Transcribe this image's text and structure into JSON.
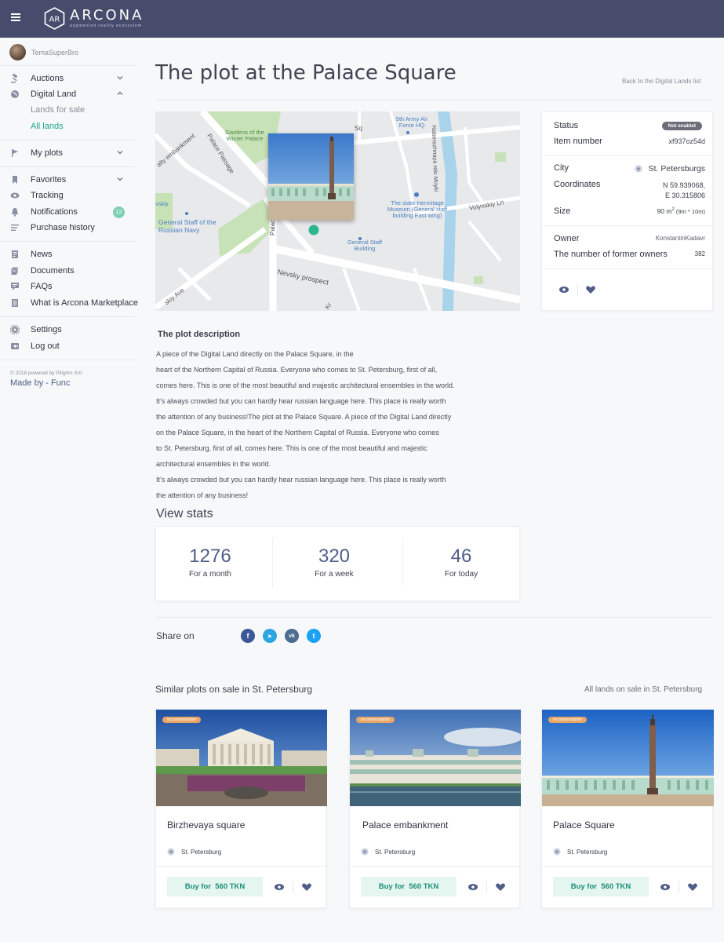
{
  "header": {
    "brand": "ARCONA",
    "tagline": "augmented reality ecosystem"
  },
  "sidebar": {
    "username": "TemaSuperBro",
    "items": [
      {
        "label": "Auctions",
        "icon": "gavel-icon"
      },
      {
        "label": "Digital Land",
        "icon": "globe-icon"
      },
      {
        "label": "My plots",
        "icon": "flag-icon"
      },
      {
        "label": "Favorites",
        "icon": "bookmark-icon"
      },
      {
        "label": "Tracking",
        "icon": "eye-icon"
      },
      {
        "label": "Notifications",
        "icon": "bell-icon"
      },
      {
        "label": "Purchase history",
        "icon": "list-icon"
      },
      {
        "label": "News",
        "icon": "document-icon"
      },
      {
        "label": "Documents",
        "icon": "documents-icon"
      },
      {
        "label": "FAQs",
        "icon": "chat-icon"
      },
      {
        "label": "What is Arcona Marketplace",
        "icon": "info-document-icon"
      },
      {
        "label": "Settings",
        "icon": "gear-icon"
      },
      {
        "label": "Log out",
        "icon": "logout-icon"
      }
    ],
    "sub_items": [
      "Lands for sale",
      "All lands"
    ],
    "notification_count": "12",
    "powered": "© 2018 powered by Piligrim XXI",
    "made_by": "Made by  -  Func"
  },
  "page": {
    "title": "The plot at the Palace Square",
    "back_link": "Back to the Digital Lands list"
  },
  "map": {
    "labels": {
      "gardens": "Gardens of the Winter Palace",
      "embankment": "alty embankment",
      "passage": "Palace Passage",
      "army": "5th Army Air Force HQ",
      "millionnaya": "Sq",
      "hermitage": "The state Hermitage Museum (General staff building East wing)",
      "general_staff": "General Staff of the Russian Navy",
      "gen_staff_building": "General Staff Building",
      "volynskiy": "Volynskiy Ln",
      "nevsky": "Nevsky prospect",
      "skiy": "vskiy",
      "ave": "skiy Ave",
      "palace": "Palac",
      "moika": "Naberezhnaya reki Moyki",
      "kr": "Kr"
    }
  },
  "info": {
    "status_label": "Status",
    "status_value": "Not enablet",
    "item_label": "Item number",
    "item_value": "xf937oz54d",
    "city_label": "City",
    "city_value": "St. Petersburgs",
    "coords_label": "Coordinates",
    "coords_lat": "N 59.939068,",
    "coords_lon": "E 30.315806",
    "size_label": "Size",
    "size_value": "90 m",
    "size_sup": "2",
    "size_detail": " (9m * 10m)",
    "owner_label": "Owner",
    "owner_value": "KonstantinKadavr",
    "former_label": "The number of former owners",
    "former_value": "382"
  },
  "description": {
    "heading": "The plot description",
    "lines": [
      "A piece of the Digital Land directly on the Palace Square, in the",
      "heart of the Northern Capital of Russia. Everyone who comes to St. Petersburg, first of all,",
      "comes here. This is one of the most beautiful and majestic architectural ensembles in the world.",
      "It’s always crowded but you can hardly hear russian language here. This place is really worth",
      " the attention of any business!The plot at the Palace Square.  A piece of the Digital Land directly",
      "on the Palace Square, in the heart of the Northern Capital of Russia. Everyone who comes",
      "to St. Petersburg, first of all, comes here. This is one of the most beautiful and majestic",
      "architectural ensembles in the world.",
      "It’s always crowded but you can hardly hear russian language here. This place is really worth",
      "the attention of any business!"
    ]
  },
  "stats": {
    "title": "View stats",
    "items": [
      {
        "value": "1276",
        "label": "For a month"
      },
      {
        "value": "320",
        "label": "For a week"
      },
      {
        "value": "46",
        "label": "For today"
      }
    ]
  },
  "share": {
    "label": "Share on",
    "networks": [
      {
        "name": "facebook",
        "glyph": "f",
        "color": "#3b5998"
      },
      {
        "name": "telegram",
        "glyph": "➤",
        "color": "#2ca5e0"
      },
      {
        "name": "vk",
        "glyph": "vk",
        "color": "#4c6c91"
      },
      {
        "name": "twitter",
        "glyph": "t",
        "color": "#1da1f2"
      }
    ]
  },
  "similar": {
    "title": "Similar plots on sale in St. Petersburg",
    "all_link": "All lands on sale in St. Petersburg",
    "badge": "recommendation",
    "plots": [
      {
        "name": "Birzhevaya square",
        "location": "St. Petersburg",
        "buy_prefix": "Buy for",
        "price": "560 TKN"
      },
      {
        "name": "Palace embankment",
        "location": "St. Petersburg",
        "buy_prefix": "Buy for",
        "price": "560 TKN"
      },
      {
        "name": "Palace Square",
        "location": "St. Petersburg",
        "buy_prefix": "Buy for",
        "price": "560 TKN"
      }
    ]
  },
  "colors": {
    "topbar": "#474c6d",
    "accent_green": "#1fa38d",
    "stat_number": "#4f5d8a",
    "badge": "#e9a566"
  }
}
